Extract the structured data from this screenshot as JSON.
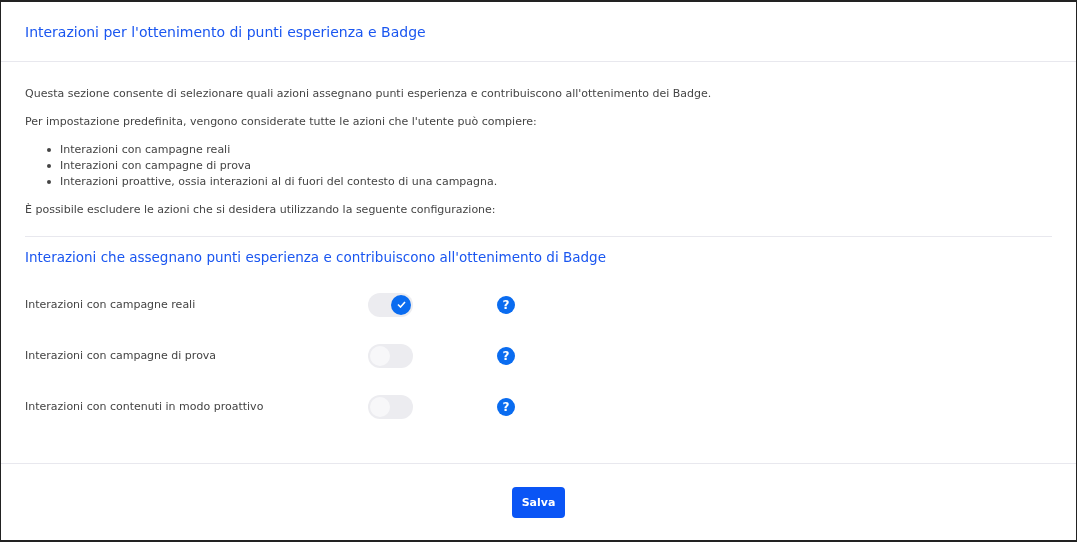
{
  "header": {
    "title": "Interazioni per l'ottenimento di punti esperienza e Badge"
  },
  "intro": {
    "paragraphs": [
      "Questa sezione consente di selezionare quali azioni assegnano punti esperienza e contribuiscono all'ottenimento dei Badge.",
      "Per impostazione predefinita, vengono considerate tutte le azioni che l'utente può compiere:"
    ],
    "bullets": [
      "Interazioni con campagne reali",
      "Interazioni con campagne di prova",
      "Interazioni proattive, ossia interazioni al di fuori del contesto di una campagna."
    ],
    "note": "È possibile escludere le azioni che si desidera utilizzando la seguente configurazione:"
  },
  "section": {
    "title": "Interazioni che assegnano punti esperienza e contribuiscono all'ottenimento di Badge",
    "settings": [
      {
        "label": "Interazioni con campagne reali",
        "on": true,
        "help": "?"
      },
      {
        "label": "Interazioni con campagne di prova",
        "on": false,
        "help": "?"
      },
      {
        "label": "Interazioni con contenuti in modo proattivo",
        "on": false,
        "help": "?"
      }
    ]
  },
  "footer": {
    "button": "Salva"
  }
}
